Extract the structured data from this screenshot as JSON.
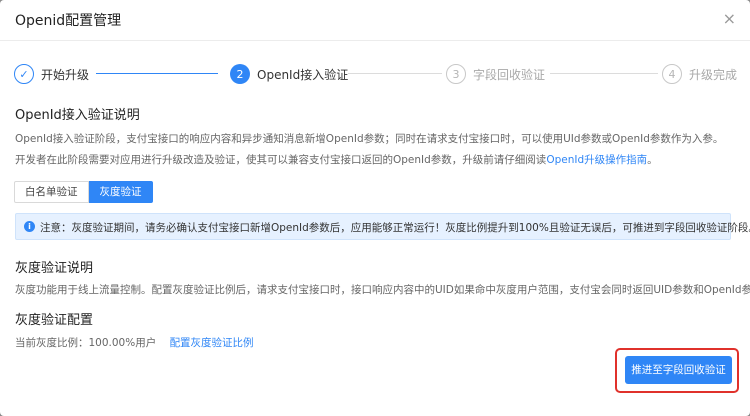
{
  "dialog": {
    "title": "Openid配置管理",
    "close_label": "×"
  },
  "steps": [
    {
      "index": "✓",
      "label": "开始升级",
      "state": "done"
    },
    {
      "index": "2",
      "label": "OpenId接入验证",
      "state": "active"
    },
    {
      "index": "3",
      "label": "字段回收验证",
      "state": "todo"
    },
    {
      "index": "4",
      "label": "升级完成",
      "state": "todo"
    }
  ],
  "intro": {
    "title": "OpenId接入验证说明",
    "line1": "OpenId接入验证阶段，支付宝接口的响应内容和异步通知消息新增OpenId参数；同时在请求支付宝接口时，可以使用UId参数或OpenId参数作为入参。",
    "line2_prefix": "开发者在此阶段需要对应用进行升级改造及验证，使其可以兼容支付宝接口返回的OpenId参数，升级前请仔细阅读",
    "line2_link": "OpenId升级操作指南",
    "line2_suffix": "。"
  },
  "tabs": [
    {
      "label": "白名单验证",
      "selected": false
    },
    {
      "label": "灰度验证",
      "selected": true
    }
  ],
  "alert": {
    "icon": "i",
    "text": "注意：灰度验证期间，请务必确认支付宝接口新增OpenId参数后，应用能够正常运行！灰度比例提升到100%且验证无误后，可推进到字段回收验证阶段。"
  },
  "gray_desc": {
    "title": "灰度验证说明",
    "text": "灰度功能用于线上流量控制。配置灰度验证比例后，请求支付宝接口时，接口响应内容中的UID如果命中灰度用户范围，支付宝会同时返回UID参数和OpenId参数。"
  },
  "gray_config": {
    "title": "灰度验证配置",
    "current_label": "当前灰度比例：100.00%用户",
    "config_link": "配置灰度验证比例"
  },
  "actions": {
    "advance_label": "推进至字段回收验证"
  },
  "colors": {
    "primary": "#2f86f6",
    "highlight": "#e0312b",
    "alert_bg": "#e6f1ff"
  }
}
